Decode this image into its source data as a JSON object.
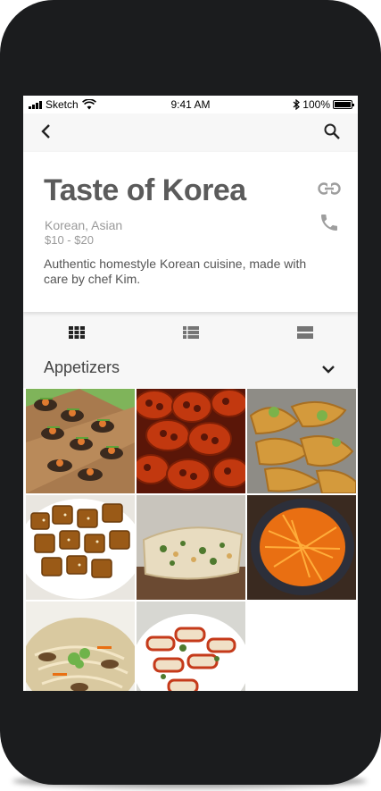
{
  "status_bar": {
    "carrier": "Sketch",
    "time": "9:41 AM",
    "battery": "100%"
  },
  "restaurant": {
    "name": "Taste of Korea",
    "cuisine": "Korean, Asian",
    "price_range": "$10 - $20",
    "description": "Authentic homestyle Korean cuisine, made with care by chef Kim."
  },
  "menu": {
    "section_title": "Appetizers"
  },
  "icons": {
    "back": "chevron-left-icon",
    "search": "search-icon",
    "link": "link-icon",
    "phone": "phone-icon",
    "grid_view": "grid-view-icon",
    "list_view": "list-view-icon",
    "card_view": "card-view-icon",
    "expand": "chevron-down-icon"
  },
  "photos": [
    "seafood-canapes",
    "glazed-lotus-root",
    "fried-tempura",
    "braised-potatoes",
    "scallion-pancake",
    "carrot-salad",
    "japchae-noodles",
    "rice-cakes"
  ],
  "colors": {
    "frame": "#1b1c1e",
    "title": "#5b5b5b",
    "icon": "#9e9e9e",
    "background": "#f7f7f7"
  }
}
